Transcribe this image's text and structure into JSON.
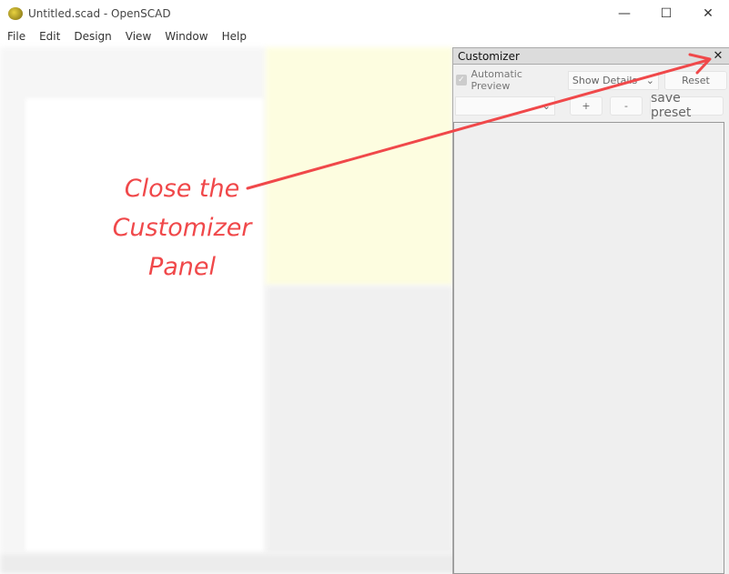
{
  "window": {
    "title": "Untitled.scad - OpenSCAD",
    "minimize": "—",
    "maximize": "☐",
    "close": "✕"
  },
  "menu": [
    "File",
    "Edit",
    "Design",
    "View",
    "Window",
    "Help"
  ],
  "customizer": {
    "title": "Customizer",
    "close": "✕",
    "auto_preview": "Automatic Preview",
    "auto_preview_checked": true,
    "details": "Show Details",
    "reset": "Reset",
    "preset": "",
    "add": "+",
    "remove": "-",
    "save_preset": "save preset"
  },
  "annotation": {
    "lines": [
      "Close the",
      "Customizer",
      "Panel"
    ],
    "color": "#f0484a"
  }
}
